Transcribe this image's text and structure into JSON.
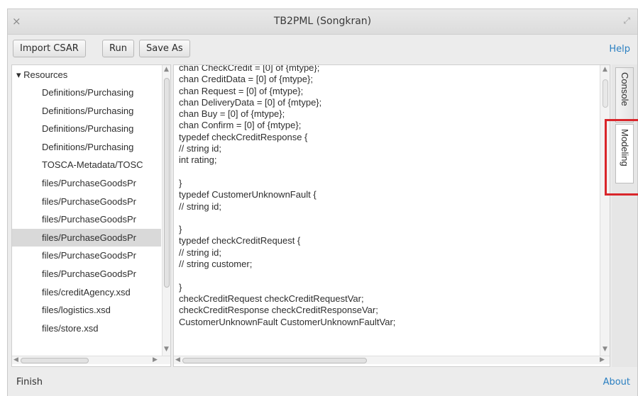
{
  "window": {
    "title": "TB2PML (Songkran)",
    "close_glyph": "×",
    "maximize_glyph": "⤢"
  },
  "toolbar": {
    "import_label": "Import CSAR",
    "run_label": "Run",
    "save_as_label": "Save As",
    "help_label": "Help"
  },
  "tree": {
    "root_label": "▾ Resources",
    "items": [
      {
        "label": "Definitions/Purchasing",
        "selected": false
      },
      {
        "label": "Definitions/Purchasing",
        "selected": false
      },
      {
        "label": "Definitions/Purchasing",
        "selected": false
      },
      {
        "label": "Definitions/Purchasing",
        "selected": false
      },
      {
        "label": "TOSCA-Metadata/TOSC",
        "selected": false
      },
      {
        "label": "files/PurchaseGoodsPr",
        "selected": false
      },
      {
        "label": "files/PurchaseGoodsPr",
        "selected": false
      },
      {
        "label": "files/PurchaseGoodsPr",
        "selected": false
      },
      {
        "label": "files/PurchaseGoodsPr",
        "selected": true
      },
      {
        "label": "files/PurchaseGoodsPr",
        "selected": false
      },
      {
        "label": "files/PurchaseGoodsPr",
        "selected": false
      },
      {
        "label": "files/creditAgency.xsd",
        "selected": false
      },
      {
        "label": "files/logistics.xsd",
        "selected": false
      },
      {
        "label": "files/store.xsd",
        "selected": false
      }
    ]
  },
  "editor": {
    "lines": [
      "chan CheckCredit = [0] of {mtype};",
      "chan CreditData = [0] of {mtype};",
      "chan Request = [0] of {mtype};",
      "chan DeliveryData = [0] of {mtype};",
      "chan Buy = [0] of {mtype};",
      "chan Confirm = [0] of {mtype};",
      "typedef checkCreditResponse {",
      "// string id;",
      "int rating;",
      "",
      "}",
      "typedef CustomerUnknownFault {",
      "// string id;",
      "",
      "}",
      "typedef checkCreditRequest {",
      "// string id;",
      "// string customer;",
      "",
      "}",
      "checkCreditRequest checkCreditRequestVar;",
      "checkCreditResponse checkCreditResponseVar;",
      "CustomerUnknownFault CustomerUnknownFaultVar;"
    ]
  },
  "side_tabs": {
    "console_label": "Console",
    "modeling_label": "Modeling"
  },
  "status": {
    "left_label": "Finish",
    "about_label": "About"
  },
  "colors": {
    "link": "#2a7fc1",
    "highlight": "#d9262b",
    "selected_row": "#d9d9d9"
  }
}
